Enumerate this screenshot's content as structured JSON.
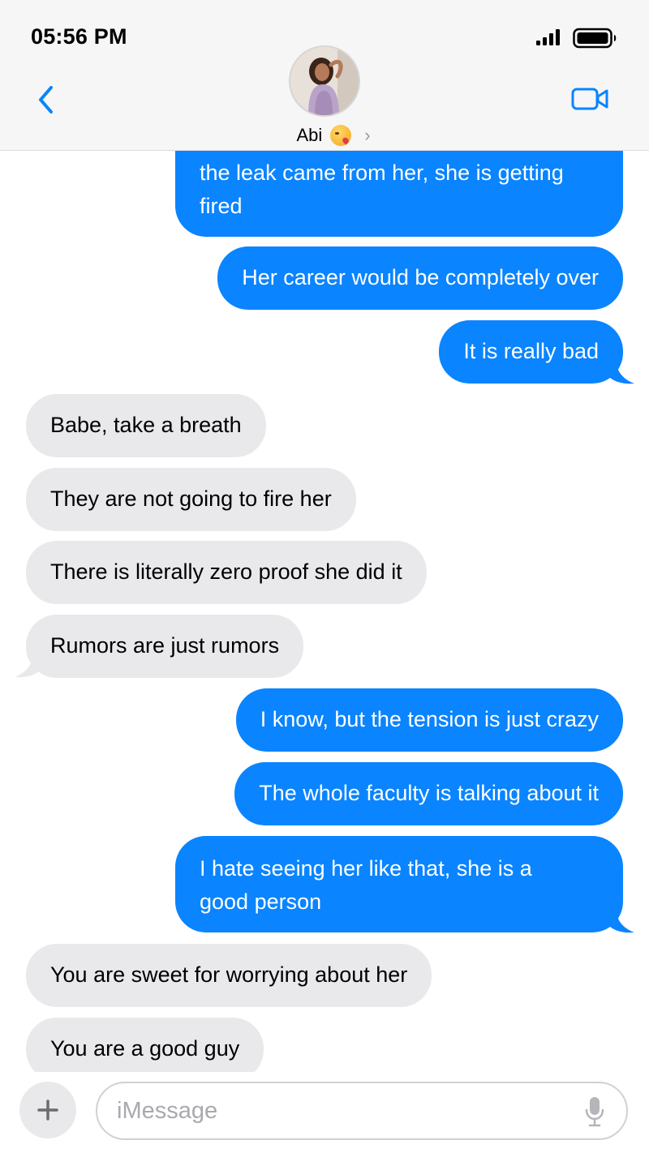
{
  "status": {
    "time": "05:56 PM"
  },
  "contact": {
    "name": "Abi"
  },
  "icons": {
    "back": "chevron-left-icon",
    "video": "video-camera-icon",
    "signal": "signal-bars-icon",
    "battery": "battery-icon",
    "add": "plus-icon",
    "mic": "microphone-icon"
  },
  "colors": {
    "accent": "#0a84ff",
    "received_bubble": "#e9e9eb"
  },
  "messages": [
    {
      "sender": "me",
      "text_line1": "the leak came from her, she is getting",
      "text_line2": "fired"
    },
    {
      "sender": "me",
      "text": "Her career would be completely over"
    },
    {
      "sender": "me",
      "text": "It is really bad"
    },
    {
      "sender": "them",
      "text": "Babe, take a breath"
    },
    {
      "sender": "them",
      "text": "They are not going to fire her"
    },
    {
      "sender": "them",
      "text": "There is literally zero proof she did it"
    },
    {
      "sender": "them",
      "text": "Rumors are just rumors"
    },
    {
      "sender": "me",
      "text": "I know, but the tension is just crazy"
    },
    {
      "sender": "me",
      "text": "The whole faculty is talking about it"
    },
    {
      "sender": "me",
      "text_line1": "I hate seeing her like that, she is a",
      "text_line2": "good person"
    },
    {
      "sender": "them",
      "text": "You are sweet for worrying about her"
    },
    {
      "sender": "them",
      "text": "You are a good guy"
    }
  ],
  "composer": {
    "placeholder": "iMessage"
  }
}
